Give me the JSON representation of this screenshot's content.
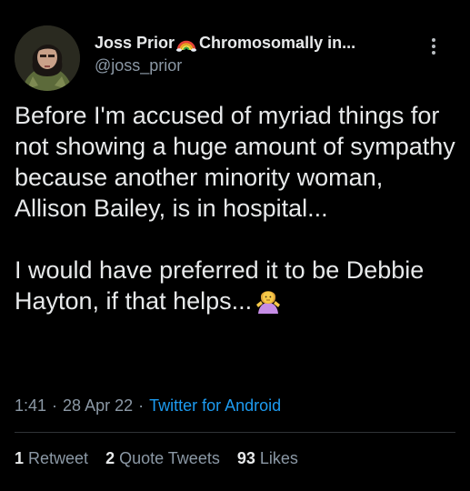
{
  "author": {
    "display_name": "Joss Prior",
    "name_suffix": "Chromosomally in...",
    "handle": "@joss_prior",
    "rainbow_icon": "rainbow-emoji"
  },
  "tweet": {
    "paragraph_1": "Before I'm accused of myriad things for not showing a huge amount of sympathy because another minority woman, Allison Bailey, is in hospital...",
    "paragraph_2": "I would have preferred it to be Debbie Hayton, if that helps...",
    "trailing_emoji": "person-shrugging-emoji"
  },
  "meta": {
    "time": "1:41",
    "separator": "·",
    "date": "28 Apr 22",
    "source": "Twitter for Android"
  },
  "stats": {
    "retweets_count": "1",
    "retweets_label": "Retweet",
    "quotes_count": "2",
    "quotes_label": "Quote Tweets",
    "likes_count": "93",
    "likes_label": "Likes"
  },
  "colors": {
    "background": "#000000",
    "text": "#e7e9ea",
    "secondary_text": "#8b98a5",
    "link": "#1d9bf0",
    "divider": "#2f3336"
  }
}
